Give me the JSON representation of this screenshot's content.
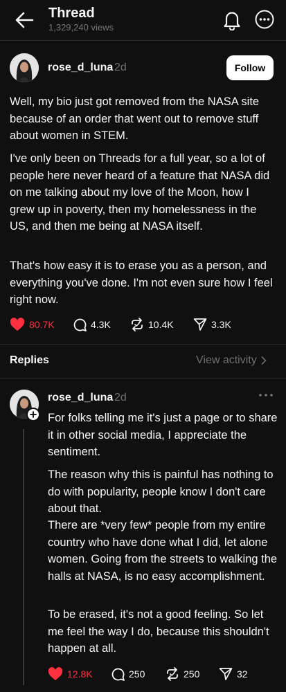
{
  "header": {
    "title": "Thread",
    "views": "1,329,240 views",
    "icons": [
      "back-arrow-icon",
      "bell-icon",
      "more-icon"
    ]
  },
  "post": {
    "username": "rose_d_luna",
    "time": "2d",
    "follow_label": "Follow",
    "paragraphs": [
      "Well, my bio just got removed from the NASA site because of an order that went out to remove stuff about women in STEM.",
      "I've only been on Threads for a full year, so a lot of people here never heard of a feature that NASA did on me talking about my love of the Moon, how I grew up in poverty, then my homelessness in the US, and then me being at NASA itself.",
      "That's how easy it is to erase you as a person, and everything you've done. I'm not even sure how I feel right now."
    ],
    "actions": {
      "likes": "80.7K",
      "comments": "4.3K",
      "reposts": "10.4K",
      "shares": "3.3K"
    }
  },
  "replies_section": {
    "label": "Replies",
    "view_activity": "View activity"
  },
  "reply": {
    "username": "rose_d_luna",
    "time": "2d",
    "paragraphs": [
      "For folks telling me it's just a page or to share it in other social media, I appreciate the sentiment.",
      "The reason why this is painful has nothing to do with popularity, people know I don't care about that.",
      "There are *very few* people from my entire country who have done what I did, let alone women. Going from the streets to walking the halls at NASA, is no easy accomplishment.",
      "To be erased, it's not a good feeling. So let me feel the way I do, because this shouldn't happen at all."
    ],
    "actions": {
      "likes": "12.8K",
      "comments": "250",
      "reposts": "250",
      "shares": "32"
    }
  },
  "colors": {
    "background": "#101010",
    "text": "#f3f5f7",
    "muted": "#6f6f6f",
    "like": "#ff3040",
    "divider": "#2a2a2a"
  }
}
